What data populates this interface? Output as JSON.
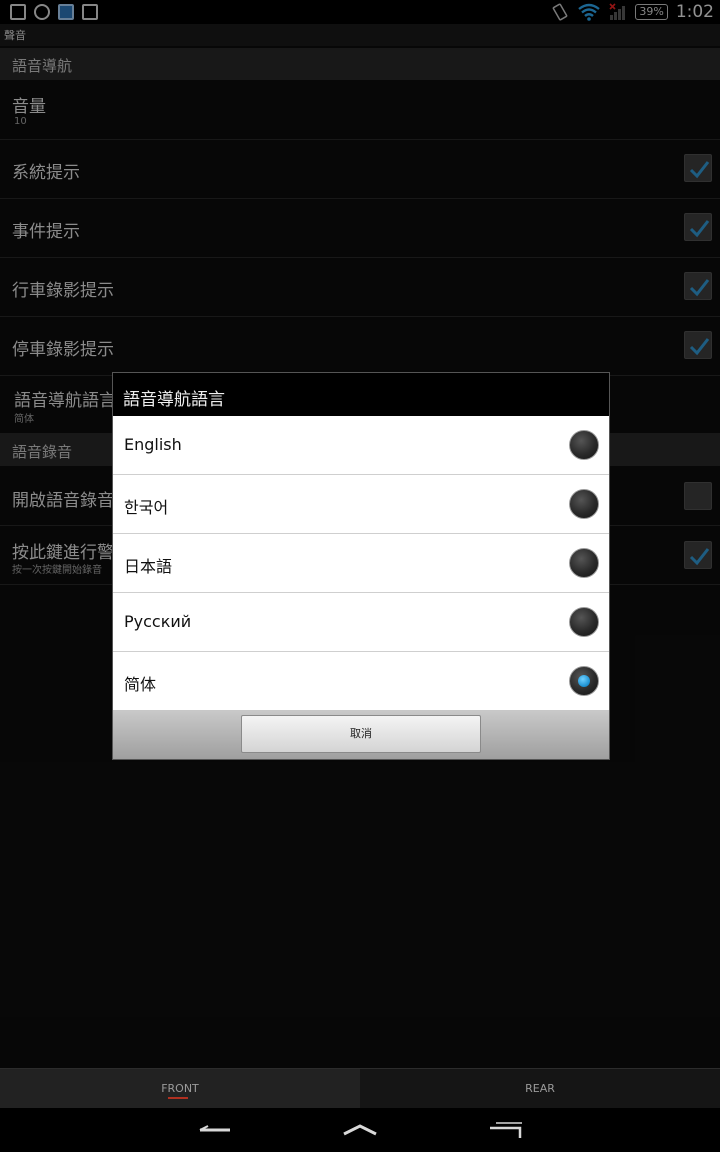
{
  "status_bar": {
    "battery": "39%",
    "time": "1:02",
    "icons": [
      "sim-icon",
      "sync-icon",
      "calendar-icon",
      "image-icon",
      "vibrate-icon",
      "wifi-icon",
      "signal-icon",
      "battery-icon"
    ]
  },
  "app": {
    "title": "聲音"
  },
  "sections": {
    "voice_nav": "語音導航",
    "voice_record": "語音錄音"
  },
  "prefs": {
    "volume": {
      "title": "音量",
      "summary": "10"
    },
    "system_prompt": {
      "title": "系統提示",
      "checked": true
    },
    "event_prompt": {
      "title": "事件提示",
      "checked": true
    },
    "driving_rec_prompt": {
      "title": "行車錄影提示",
      "checked": true
    },
    "parking_rec_prompt": {
      "title": "停車錄影提示",
      "checked": true
    },
    "nav_language": {
      "title": "語音導航語言",
      "summary": "简体"
    },
    "enable_voice_rec": {
      "title": "開啟語音錄音",
      "checked": false
    },
    "press_key_alert": {
      "title": "按此鍵進行警",
      "summary": "按一次按鍵開始錄音",
      "checked": true
    }
  },
  "dialog": {
    "title": "語音導航語言",
    "options": [
      {
        "label": "English",
        "selected": false
      },
      {
        "label": "한국어",
        "selected": false
      },
      {
        "label": "日本語",
        "selected": false
      },
      {
        "label": "Русский",
        "selected": false
      },
      {
        "label": "简体",
        "selected": true
      }
    ],
    "cancel_label": "取消"
  },
  "tabs": {
    "front": "FRONT",
    "rear": "REAR"
  },
  "colors": {
    "accent_blue": "#1a8fd0",
    "check_blue": "#2f8fc8",
    "tab_indicator": "#b03020"
  }
}
